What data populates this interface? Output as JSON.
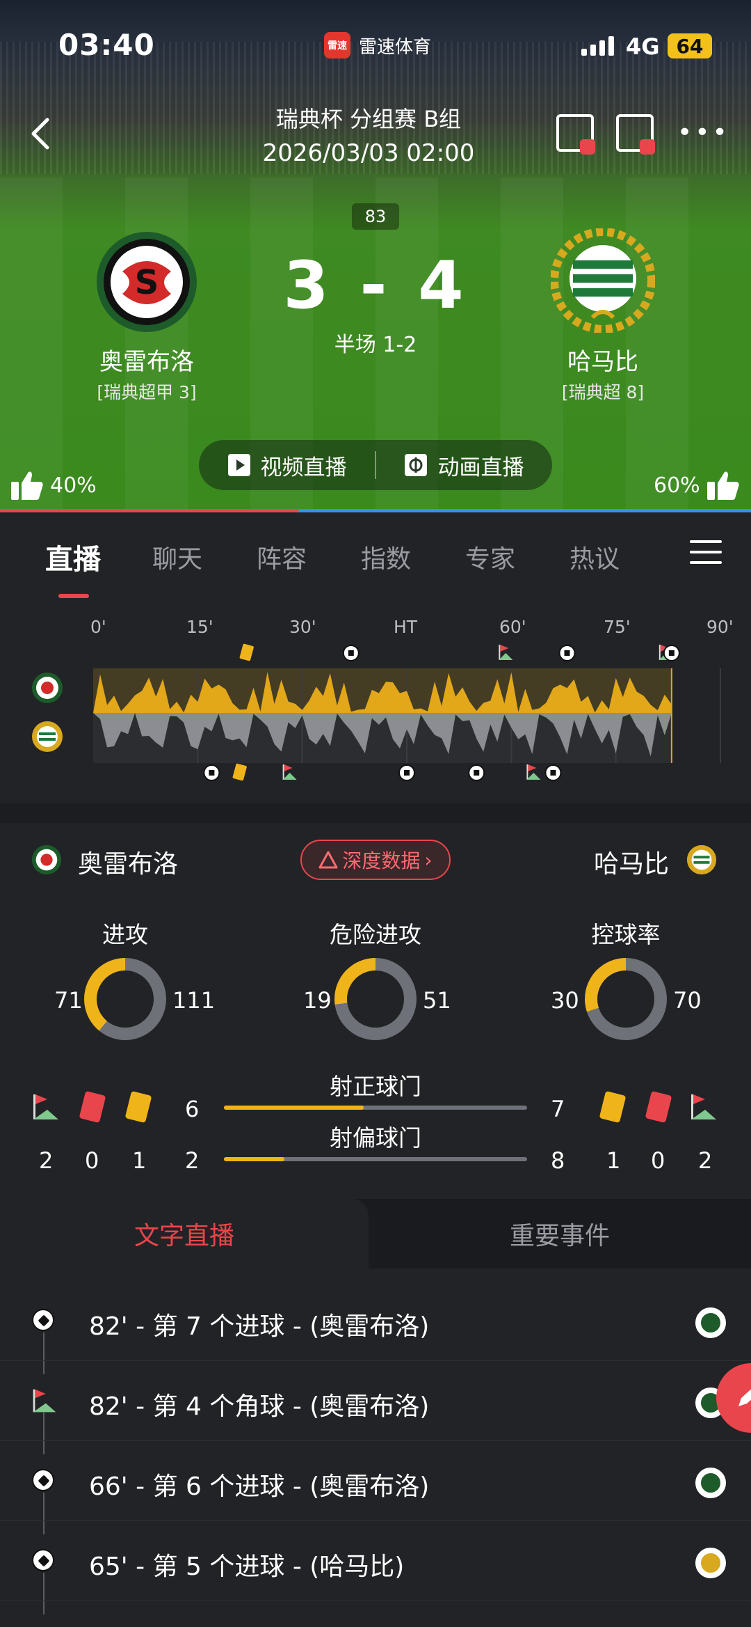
{
  "status_bar": {
    "time": "03:40",
    "app_name": "雷速体育",
    "app_logo_text": "雷速",
    "network": "4G",
    "battery": "64"
  },
  "match": {
    "league": "瑞典杯 分组赛 B组",
    "datetime": "2026/03/03 02:00",
    "minute": "83",
    "score": "3 - 4",
    "halftime": "半场 1-2",
    "home": {
      "name": "奥雷布洛",
      "rank": "[瑞典超甲 3]",
      "support": "40%"
    },
    "away": {
      "name": "哈马比",
      "rank": "[瑞典超 8]",
      "support": "60%"
    }
  },
  "stream_buttons": {
    "video": "视频直播",
    "animation": "动画直播"
  },
  "tabs": [
    "直播",
    "聊天",
    "阵容",
    "指数",
    "专家",
    "热议"
  ],
  "timeline": {
    "ticks": [
      "0'",
      "15'",
      "30'",
      "HT",
      "60'",
      "75'",
      "90'"
    ],
    "current_minute": 83,
    "home_events": [
      {
        "minute": 22,
        "type": "yellow-card"
      },
      {
        "minute": 37,
        "type": "goal"
      },
      {
        "minute": 59,
        "type": "corner"
      },
      {
        "minute": 68,
        "type": "goal"
      },
      {
        "minute": 82,
        "type": "corner"
      },
      {
        "minute": 83,
        "type": "goal"
      }
    ],
    "away_events": [
      {
        "minute": 17,
        "type": "goal"
      },
      {
        "minute": 21,
        "type": "yellow-card"
      },
      {
        "minute": 28,
        "type": "corner"
      },
      {
        "minute": 45,
        "type": "goal"
      },
      {
        "minute": 55,
        "type": "goal"
      },
      {
        "minute": 63,
        "type": "corner"
      },
      {
        "minute": 66,
        "type": "goal"
      }
    ]
  },
  "stats": {
    "home_name": "奥雷布洛",
    "away_name": "哈马比",
    "deep_data": "深度数据",
    "rings": [
      {
        "label": "进攻",
        "home": "71",
        "away": "111",
        "home_value": 71,
        "away_value": 111
      },
      {
        "label": "危险进攻",
        "home": "19",
        "away": "51",
        "home_value": 19,
        "away_value": 51
      },
      {
        "label": "控球率",
        "home": "30",
        "away": "70",
        "home_value": 30,
        "away_value": 70
      }
    ],
    "bars": [
      {
        "label": "射正球门",
        "home": "6",
        "away": "7",
        "home_value": 6,
        "away_value": 7
      },
      {
        "label": "射偏球门",
        "home": "2",
        "away": "8",
        "home_value": 2,
        "away_value": 8
      }
    ],
    "home_counts": {
      "corners": "2",
      "red": "0",
      "yellow": "1"
    },
    "away_counts": {
      "yellow": "1",
      "red": "0",
      "corners": "2"
    }
  },
  "colors": {
    "home": "#f0b41b",
    "away": "#6f7178",
    "accent": "#e8464c",
    "blue": "#3a8ff0"
  },
  "live_tabs": {
    "text_live": "文字直播",
    "key_events": "重要事件"
  },
  "live_feed": [
    {
      "icon": "ball-icon",
      "text": "82' - 第 7 个进球 - (奥雷布洛)",
      "team": "home"
    },
    {
      "icon": "corner-flag-icon",
      "text": "82' - 第 4 个角球 - (奥雷布洛)",
      "team": "home"
    },
    {
      "icon": "ball-icon",
      "text": "66' - 第 6 个进球 - (奥雷布洛)",
      "team": "home"
    },
    {
      "icon": "ball-icon",
      "text": "65' - 第 5 个进球 - (哈马比)",
      "team": "away"
    }
  ]
}
